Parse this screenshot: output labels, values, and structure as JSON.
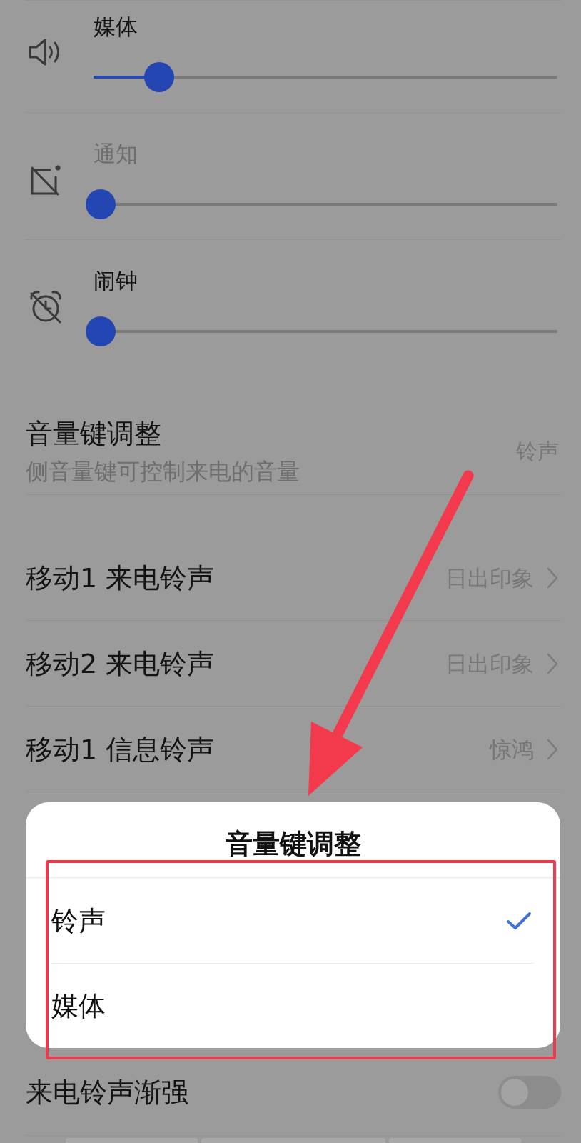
{
  "volume_sliders": [
    {
      "label": "媒体",
      "level": 0.13,
      "disabled": false
    },
    {
      "label": "通知",
      "level": 0,
      "disabled": true
    },
    {
      "label": "闹钟",
      "level": 0,
      "disabled": false
    }
  ],
  "volume_key_setting": {
    "title": "音量键调整",
    "subtitle": "侧音量键可控制来电的音量",
    "value": "铃声"
  },
  "ringtone_rows": [
    {
      "title": "移动1 来电铃声",
      "value": "日出印象"
    },
    {
      "title": "移动2 来电铃声",
      "value": "日出印象"
    },
    {
      "title": "移动1 信息铃声",
      "value": "惊鸿"
    }
  ],
  "fade_in_row": {
    "title": "来电铃声渐强",
    "on": false
  },
  "dialog": {
    "title": "音量键调整",
    "options": [
      {
        "label": "铃声",
        "selected": true
      },
      {
        "label": "媒体",
        "selected": false
      }
    ]
  }
}
